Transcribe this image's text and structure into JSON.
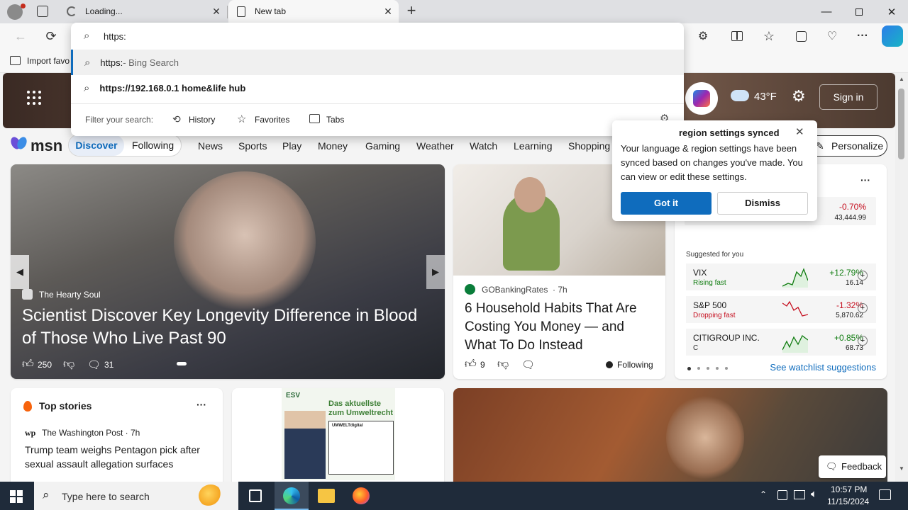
{
  "browser": {
    "tabs": [
      {
        "label": "Loading..."
      },
      {
        "label": "New tab"
      }
    ],
    "address_value": "https:",
    "favorites_bar": {
      "import_label": "Import favo"
    }
  },
  "omnibox": {
    "suggestions": [
      {
        "bold": "https:",
        "rest": " - Bing Search"
      },
      {
        "bold": "https://192.168.0.1 home&life hub",
        "rest": ""
      }
    ],
    "filter_label": "Filter your search:",
    "filters": [
      "History",
      "Favorites",
      "Tabs"
    ]
  },
  "msn": {
    "logo": "msn",
    "weather": "43°F",
    "sign_in": "Sign in",
    "nav_pills": [
      "Discover",
      "Following"
    ],
    "nav_links": [
      "News",
      "Sports",
      "Play",
      "Money",
      "Gaming",
      "Weather",
      "Watch",
      "Learning",
      "Shopping"
    ],
    "personalize": "Personalize",
    "hero": {
      "source": "The Hearty Soul",
      "title": "Scientist Discover Key Longevity Difference in Blood of Those Who Live Past 90",
      "likes": "250",
      "comments": "31"
    },
    "article2": {
      "source": "GOBankingRates",
      "time": "· 7h",
      "title": "6 Household Habits That Are Costing You Money — and What To Do Instead",
      "likes": "9",
      "following": "Following"
    },
    "top_stories": {
      "heading": "Top stories",
      "source": "The Washington Post · 7h",
      "headline": "Trump team weighs Pentagon pick after sexual assault allegation surfaces"
    },
    "ad": {
      "text1": "Das aktuellste",
      "text2": "zum Umweltrecht",
      "badge": "ESV",
      "site": "UMWELTdigital"
    },
    "watchlist": {
      "top_change": "-0.70%",
      "top_value": "43,444.99",
      "suggested_label": "Suggested for you",
      "rows": [
        {
          "name": "VIX",
          "sub": "Rising fast",
          "change": "+12.79%",
          "value": "16.14"
        },
        {
          "name": "S&P 500",
          "sub": "Dropping fast",
          "change": "-1.32%",
          "value": "5,870.62"
        },
        {
          "name": "CITIGROUP INC.",
          "sub": "C",
          "change": "+0.85%",
          "value": "68.73"
        }
      ],
      "see_more": "See watchlist suggestions"
    },
    "feedback": "Feedback"
  },
  "popup": {
    "title": "region settings synced",
    "body": "Your language & region settings have been synced based on changes you've made. You can view or edit these settings.",
    "got_it": "Got it",
    "dismiss": "Dismiss"
  },
  "taskbar": {
    "search_placeholder": "Type here to search",
    "time": "10:57 PM",
    "date": "11/15/2024"
  },
  "colors": {
    "accent": "#0f6cbd",
    "up": "#107c10",
    "down": "#c50f1f"
  }
}
